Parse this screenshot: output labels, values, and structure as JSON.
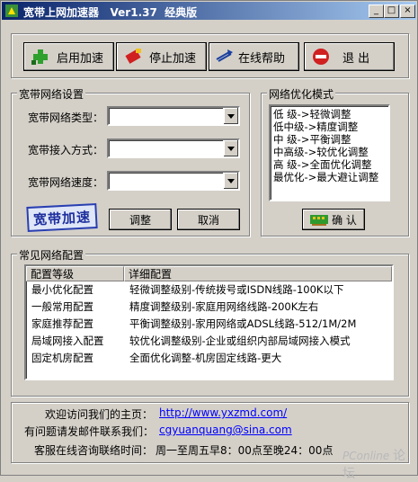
{
  "window": {
    "title": "宽带上网加速器   Ver1.37  经典版",
    "min": "_",
    "max": "□",
    "close": "×"
  },
  "toolbar": {
    "start_label": "启用加速",
    "stop_label": "停止加速",
    "help_label": "在线帮助",
    "exit_label": "退   出"
  },
  "settings": {
    "group_label": "宽带网络设置",
    "type_label": "宽带网络类型：",
    "access_label": "宽带接入方式：",
    "speed_label": "宽带网络速度：",
    "logo_text": "宽带加速",
    "adjust_label": "调整",
    "cancel_label": "取消"
  },
  "optimize": {
    "group_label": "网络优化模式",
    "modes": [
      "低  级->轻微调整",
      "低中级->精度调整",
      "中  级->平衡调整",
      "中高级->较优化调整",
      "高  级->全面优化调整",
      "最优化->最大避让调整"
    ],
    "confirm_label": "确 认"
  },
  "common": {
    "group_label": "常见网络配置",
    "columns": [
      "配置等级",
      "详细配置"
    ],
    "rows": [
      {
        "level": "最小优化配置",
        "detail": "轻微调整级别-传统拨号或ISDN线路-100K以下"
      },
      {
        "level": "一般常用配置",
        "detail": "精度调整级别-家庭用网络线路-200K左右"
      },
      {
        "level": "家庭推荐配置",
        "detail": "平衡调整级别-家用网络或ADSL线路-512/1M/2M"
      },
      {
        "level": "局域网接入配置",
        "detail": "较优化调整级别-企业或组织内部局域网接入模式"
      },
      {
        "level": "固定机房配置",
        "detail": "全面优化调整-机房固定线路-更大"
      }
    ]
  },
  "footer": {
    "homepage_label": "欢迎访问我们的主页：",
    "homepage_url": "http://www.yxzmd.com/",
    "email_label": "有问题请发邮件联系我们：",
    "email": "cgyuanquang@sina.com",
    "service_label": "客服在线咨询联络时间：",
    "service_time": "周一至周五早8：00点至晚24：00点"
  },
  "watermark": {
    "brand": "PConline",
    "suffix": "论坛"
  }
}
